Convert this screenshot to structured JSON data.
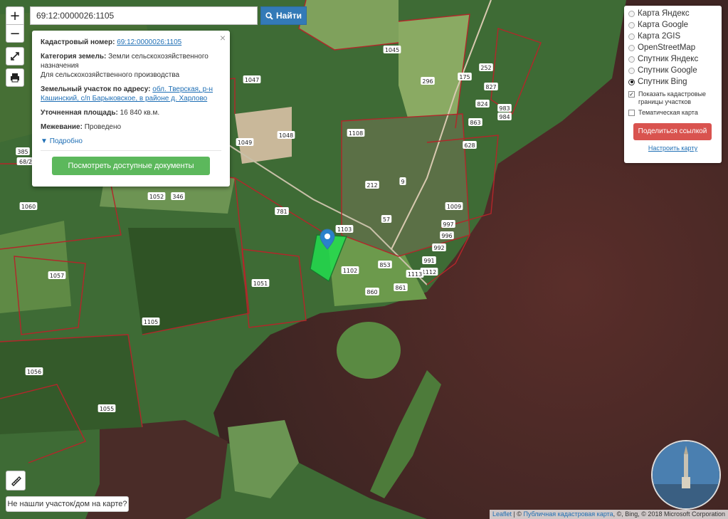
{
  "map": {
    "parcel_numbers": [
      "1045",
      "1047",
      "296",
      "175",
      "252",
      "827",
      "824",
      "983",
      "863",
      "984",
      "628",
      "1108",
      "1048",
      "1049",
      "385",
      "68/2",
      "1052",
      "346",
      "1060",
      "781",
      "212",
      "9",
      "1009",
      "1103",
      "57",
      "997",
      "996",
      "992",
      "991",
      "1102",
      "853",
      "1112",
      "1113",
      "860",
      "861",
      "1057",
      "1051",
      "1105",
      "1056",
      "1055"
    ]
  },
  "controls": {
    "zoom_in": "+",
    "zoom_out": "−"
  },
  "search": {
    "value": "69:12:0000026:1105",
    "button_label": "Найти"
  },
  "popup": {
    "close": "×",
    "cadastral_label": "Кадастровый номер:",
    "cadastral_value": "69:12:0000026:1105",
    "category_label": "Категория земель:",
    "category_value": "Земли сельскохозяйственного назначения",
    "category_extra": "Для сельскохозяйственного производства",
    "address_label": "Земельный участок по адресу:",
    "address_value": "обл. Тверская, р-н Кашинский, с/п Барыковское, в районе д. Харлово",
    "area_label": "Уточненная площадь:",
    "area_value": "16 840 кв.м.",
    "survey_label": "Межевание:",
    "survey_value": "Проведено",
    "more_label": "Подробно",
    "docs_button": "Посмотреть доступные документы"
  },
  "layers": {
    "items": [
      {
        "label": "Карта Яндекс",
        "selected": false
      },
      {
        "label": "Карта Google",
        "selected": false
      },
      {
        "label": "Карта 2GIS",
        "selected": false
      },
      {
        "label": "OpenStreetMap",
        "selected": false
      },
      {
        "label": "Спутник Яндекс",
        "selected": false
      },
      {
        "label": "Спутник Google",
        "selected": false
      },
      {
        "label": "Спутник Bing",
        "selected": true
      }
    ],
    "show_borders_label": "Показать кадастровые границы участков",
    "show_borders_checked": true,
    "thematic_label": "Тематическая карта",
    "thematic_checked": false,
    "share_button": "Поделиться ссылкой",
    "settings_link": "Настроить карту"
  },
  "bottom": {
    "not_found": "Не нашли участок/дом на карте?",
    "attr_leaflet": "Leaflet",
    "attr_sep1": " | © ",
    "attr_pkk": "Публичная кадастровая карта",
    "attr_rest": ", ©, Bing, © 2018 Microsoft Corporation"
  }
}
